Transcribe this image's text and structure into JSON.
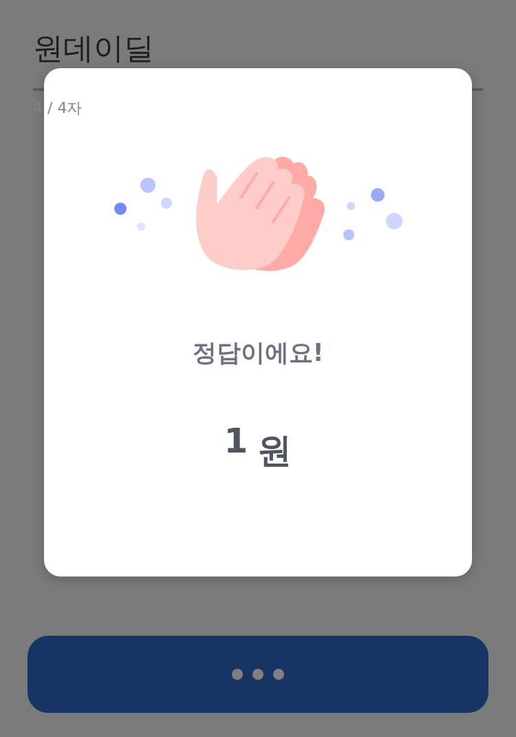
{
  "page": {
    "title": "원데이딜",
    "counter": "4 / 4자"
  },
  "dialog": {
    "message": "정답이에요!",
    "amount": "1",
    "unit": "원"
  },
  "button": {
    "loading": true
  }
}
